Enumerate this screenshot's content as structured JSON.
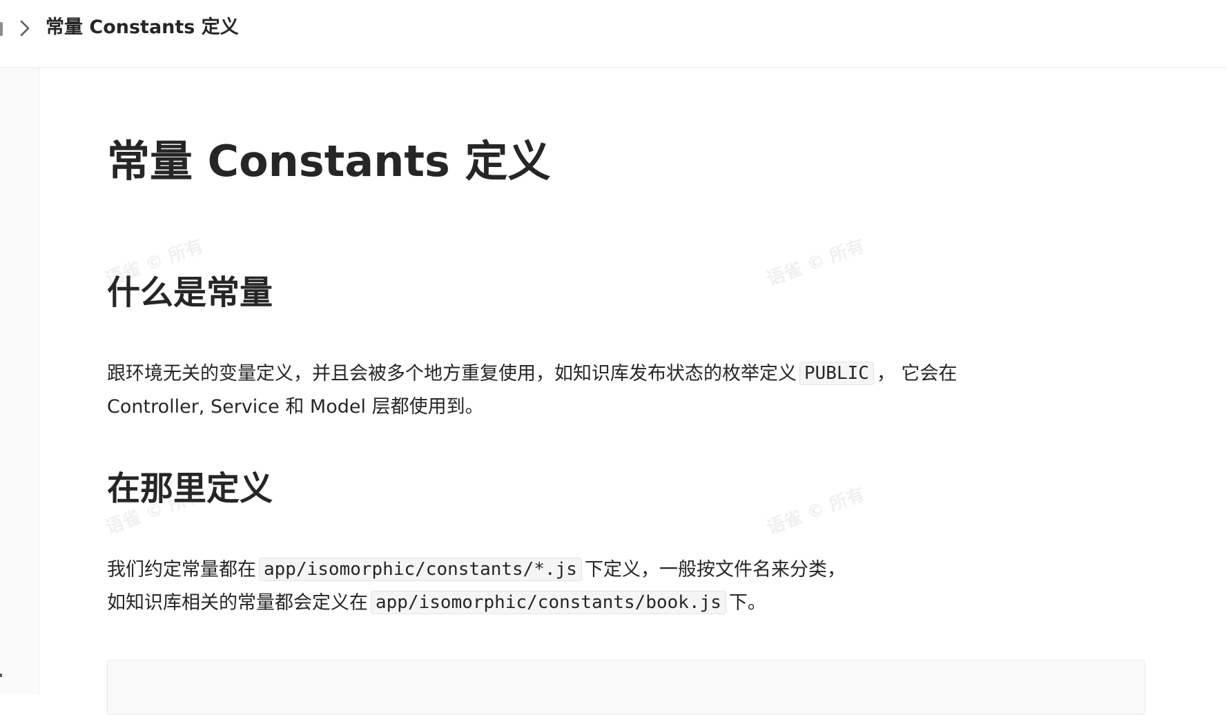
{
  "header": {
    "breadcrumb_title": "常量 Constants 定义"
  },
  "doc": {
    "title": "常量 Constants 定义",
    "sections": [
      {
        "heading": "什么是常量",
        "line1_before": "跟环境无关的变量定义，并且会被多个地方重复使用，如知识库发布状态的枚举定义",
        "line1_code": "PUBLIC",
        "line1_after": "， 它会在",
        "line2": "Controller, Service 和 Model 层都使用到。"
      },
      {
        "heading": "在那里定义",
        "line1_before": "我们约定常量都在",
        "line1_code": "app/isomorphic/constants/*.js",
        "line1_after": "下定义，一般按文件名来分类，",
        "line2_before": "如知识库相关的常量都会定义在",
        "line2_code": "app/isomorphic/constants/book.js",
        "line2_after": "下。"
      }
    ]
  },
  "watermark_text": "语雀 © 所有",
  "icons": {
    "breadcrumb_separator": "chevron-right-icon"
  }
}
